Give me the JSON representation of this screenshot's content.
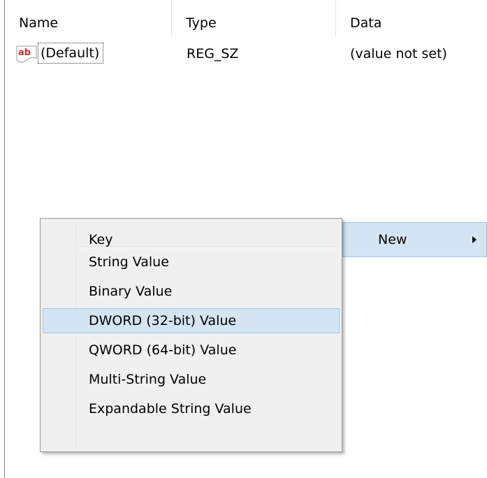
{
  "columns": {
    "name": "Name",
    "type": "Type",
    "data": "Data"
  },
  "rows": [
    {
      "icon": "string-value-icon",
      "name": "(Default)",
      "type": "REG_SZ",
      "data": "(value not set)"
    }
  ],
  "new_item": {
    "label": "New",
    "arrow_icon": "submenu-arrow-icon"
  },
  "context_menu": {
    "items": [
      {
        "label": "Key"
      },
      {
        "label": "String Value"
      },
      {
        "label": "Binary Value"
      },
      {
        "label": "DWORD (32-bit) Value",
        "highlighted": true
      },
      {
        "label": "QWORD (64-bit) Value"
      },
      {
        "label": "Multi-String Value"
      },
      {
        "label": "Expandable String Value"
      }
    ]
  },
  "colors": {
    "highlight_bg": "#d5e4f3",
    "highlight_border": "#a2c4e8",
    "menu_bg": "#f0f0f0",
    "icon_ab_red": "#d0322c"
  }
}
